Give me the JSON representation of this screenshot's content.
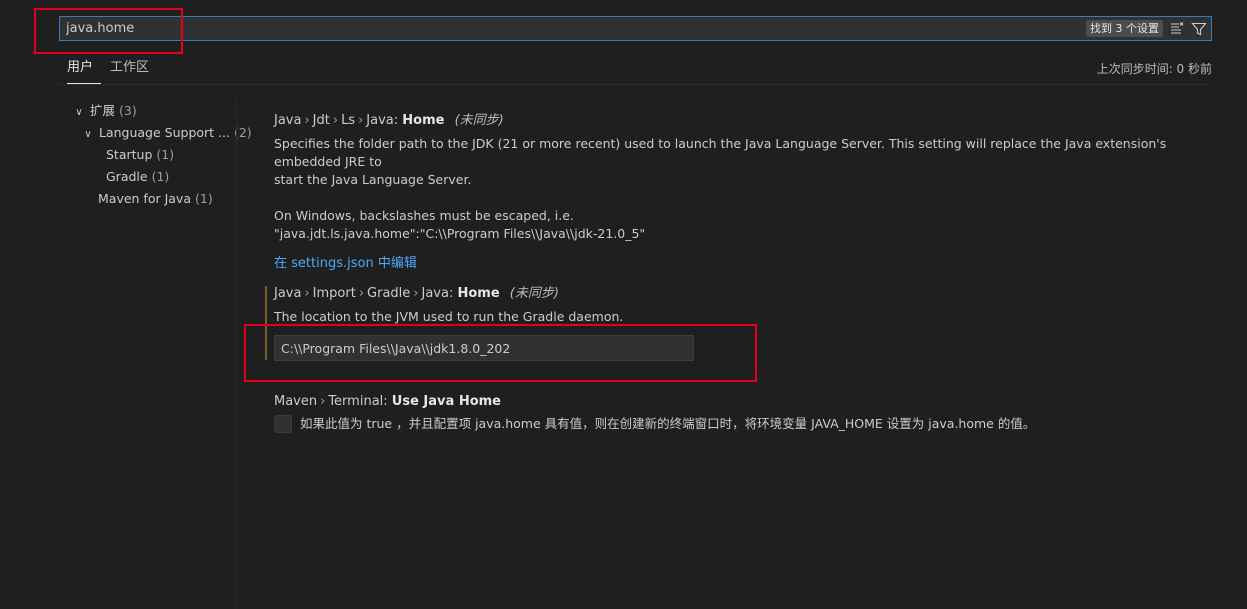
{
  "search": {
    "value": "java.home",
    "results_badge": "找到 3 个设置",
    "clear_filter_icon": "clear-filter-icon",
    "filter_icon": "filter-icon"
  },
  "tabs": [
    {
      "label": "用户",
      "active": true
    },
    {
      "label": "工作区",
      "active": false
    }
  ],
  "sync_status": "上次同步时间: 0 秒前",
  "toc": {
    "items": [
      {
        "label": "扩展",
        "count": "(3)",
        "expanded": true
      },
      {
        "label": "Language Support ...",
        "count": "(2)",
        "expanded": true
      },
      {
        "label": "Startup",
        "count": "(1)"
      },
      {
        "label": "Gradle",
        "count": "(1)"
      },
      {
        "label": "Maven for Java",
        "count": "(1)"
      }
    ]
  },
  "settings": [
    {
      "breadcrumb": [
        "Java",
        "Jdt",
        "Ls",
        "Java:"
      ],
      "name": "Home",
      "unsynced": "(未同步)",
      "description_lines": [
        "Specifies the folder path to the JDK (21 or more recent) used to launch the Java Language Server. This setting will replace the Java extension's embedded JRE to",
        "start the Java Language Server.",
        "",
        "On Windows, backslashes must be escaped, i.e.",
        "\"java.jdt.ls.java.home\":\"C:\\\\Program Files\\\\Java\\\\jdk-21.0_5\""
      ],
      "link": "在 settings.json 中编辑"
    },
    {
      "breadcrumb": [
        "Java",
        "Import",
        "Gradle",
        "Java:"
      ],
      "name": "Home",
      "unsynced": "(未同步)",
      "description": "The location to the JVM used to run the Gradle daemon.",
      "value": "C:\\\\Program Files\\\\Java\\\\jdk1.8.0_202"
    },
    {
      "breadcrumb": [
        "Maven",
        "Terminal:"
      ],
      "name": "Use Java Home",
      "checkbox_label": "如果此值为 true ，并且配置项 java.home 具有值，则在创建新的终端窗口时，将环境变量 JAVA_HOME 设置为 java.home 的值。",
      "checked": false
    }
  ],
  "colors": {
    "background": "#1f1f1f",
    "accent": "#2f7dc2",
    "link": "#4daafc",
    "highlight_box": "#e3001b",
    "modified_indicator": "#7c5b2a"
  }
}
